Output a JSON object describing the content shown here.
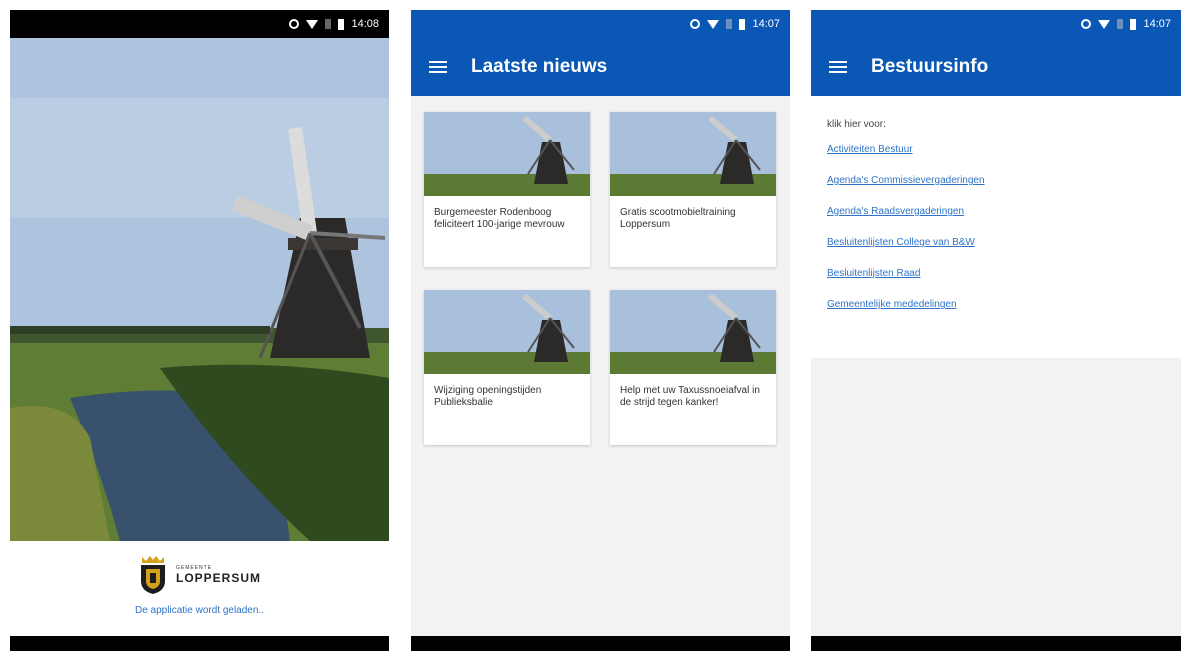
{
  "screens": [
    {
      "status": {
        "time": "14:08"
      },
      "splash": {
        "logo_small": "GEMEENTE",
        "logo_name": "LOPPERSUM",
        "loading_text": "De applicatie wordt geladen.."
      }
    },
    {
      "status": {
        "time": "14:07"
      },
      "appbar": {
        "title": "Laatste nieuws",
        "menu_icon": "hamburger-icon"
      },
      "news": [
        {
          "title": "Burgemeester Rodenboog feliciteert 100-jarige mevrouw"
        },
        {
          "title": "Gratis scootmobieltraining Loppersum"
        },
        {
          "title": "Wijziging openingstijden Publieksbalie"
        },
        {
          "title": "Help met uw Taxussnoeiafval in de strijd tegen kanker!"
        }
      ]
    },
    {
      "status": {
        "time": "14:07"
      },
      "appbar": {
        "title": "Bestuursinfo",
        "menu_icon": "hamburger-icon"
      },
      "info": {
        "intro": "klik hier voor:",
        "links": [
          "Activiteiten Bestuur",
          "Agenda's Commissievergaderingen",
          "Agenda's Raadsvergaderingen",
          "Besluitenlijsten College van B&W",
          "Besluitenlijsten Raad",
          "Gemeentelijke mededelingen"
        ]
      }
    }
  ],
  "colors": {
    "primary": "#0a57b5",
    "link": "#2e73c8",
    "background": "#f2f2f2"
  }
}
